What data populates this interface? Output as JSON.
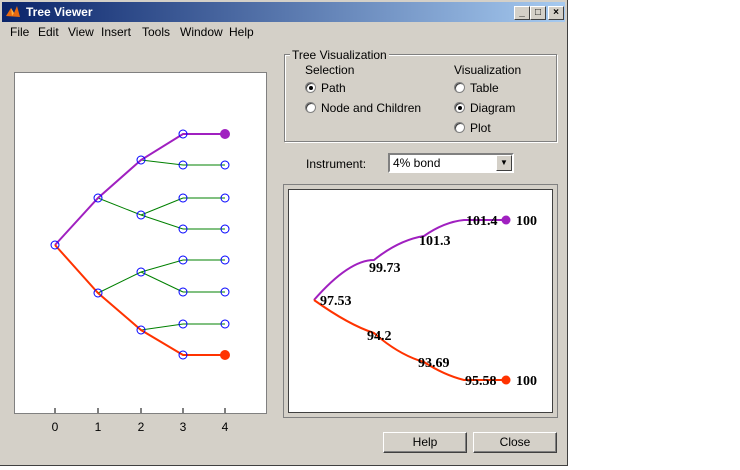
{
  "window": {
    "title": "Tree Viewer"
  },
  "titlebar_buttons": {
    "minimize": "_",
    "maximize": "□",
    "close": "×"
  },
  "menu": [
    "File",
    "Edit",
    "View",
    "Insert",
    "Tools",
    "Window",
    "Help"
  ],
  "tree_plot": {
    "x_ticks": [
      "0",
      "1",
      "2",
      "3",
      "4"
    ],
    "colors": {
      "up_path": "#a020c0",
      "down_path": "#ff3300",
      "branch": "#008000",
      "node": "#0000ff"
    }
  },
  "tree_visualization": {
    "legend": "Tree Visualization",
    "selection_heading": "Selection",
    "selection_options": [
      {
        "label": "Path",
        "selected": true
      },
      {
        "label": "Node and Children",
        "selected": false
      }
    ],
    "visualization_heading": "Visualization",
    "visualization_options": [
      {
        "label": "Table",
        "selected": false
      },
      {
        "label": "Diagram",
        "selected": true
      },
      {
        "label": "Plot",
        "selected": false
      }
    ]
  },
  "instrument": {
    "label": "Instrument:",
    "value": "4% bond"
  },
  "diagram": {
    "root": "97.53",
    "upper": [
      "99.73",
      "101.3",
      "101.4",
      "100"
    ],
    "lower": [
      "94.2",
      "93.69",
      "95.58",
      "100"
    ]
  },
  "buttons": {
    "help": "Help",
    "close": "Close"
  }
}
